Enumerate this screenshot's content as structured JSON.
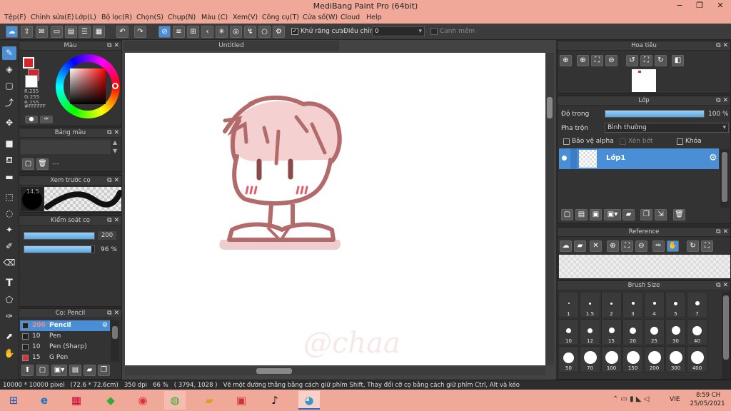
{
  "window": {
    "title": "MediBang Paint Pro (64bit)",
    "minimize": "−",
    "restore": "❐",
    "close": "✕"
  },
  "menu": [
    "Tệp(F)",
    "Chỉnh sửa(E)",
    "Lớp(L)",
    "Bộ lọc(R)",
    "Chọn(S)",
    "Chụp(N)",
    "Màu (C)",
    "Xem(V)",
    "Công cụ(T)",
    "Cửa số(W)",
    "Cloud",
    "Help"
  ],
  "toolbar": {
    "antialias_label": "Khử răng cưa",
    "adjust_label": "Điều chỉnh",
    "adjust_value": "0",
    "snap_label": "Canh mềm"
  },
  "color_panel": {
    "title": "Màu",
    "r": "R:255",
    "g": "G:255",
    "b": "B:255",
    "hex": "#FFFFFF",
    "fg": "#d9232a",
    "bg": "#ffffff"
  },
  "palette_panel": {
    "title": "Bảng màu",
    "dash": "---"
  },
  "brush_preview": {
    "title": "Xem trước cọ",
    "size": "14.5"
  },
  "brush_control": {
    "title": "Kiểm soát cọ",
    "size_value": "200",
    "opacity_value": "96 %",
    "size_fill": 1.0,
    "opacity_fill": 0.96
  },
  "brush_list": {
    "title": "Cọ: Pencil",
    "items": [
      {
        "size": "200",
        "name": "Pencil",
        "color": "#222222",
        "selected": true
      },
      {
        "size": "10",
        "name": "Pen",
        "color": "#222222",
        "selected": false
      },
      {
        "size": "10",
        "name": "Pen (Sharp)",
        "color": "#222222",
        "selected": false
      },
      {
        "size": "15",
        "name": "G Pen",
        "color": "#e03030",
        "selected": false
      }
    ]
  },
  "canvas": {
    "tab": "Untitled"
  },
  "navigator": {
    "title": "Hoa tiêu"
  },
  "layer_panel": {
    "title": "Lớp",
    "opacity_label": "Độ trong",
    "opacity_value": "100 %",
    "opacity_fill": 1.0,
    "blend_label": "Pha trộn",
    "blend_value": "Bình thường",
    "protect_alpha": "Bảo vệ alpha",
    "clipping": "Xén bớt",
    "lock": "Khóa",
    "layers": [
      {
        "name": "Lớp1"
      }
    ]
  },
  "reference_panel": {
    "title": "Reference"
  },
  "brush_size_panel": {
    "title": "Brush Size",
    "sizes": [
      {
        "label": "1",
        "v": 1
      },
      {
        "label": "1.5",
        "v": 1.5
      },
      {
        "label": "2",
        "v": 2
      },
      {
        "label": "3",
        "v": 3
      },
      {
        "label": "4",
        "v": 4
      },
      {
        "label": "5",
        "v": 5
      },
      {
        "label": "7",
        "v": 7
      },
      {
        "label": "10",
        "v": 10
      },
      {
        "label": "12",
        "v": 12
      },
      {
        "label": "15",
        "v": 15
      },
      {
        "label": "20",
        "v": 20
      },
      {
        "label": "25",
        "v": 25
      },
      {
        "label": "30",
        "v": 30
      },
      {
        "label": "40",
        "v": 40
      },
      {
        "label": "50",
        "v": 50
      },
      {
        "label": "70",
        "v": 70
      },
      {
        "label": "100",
        "v": 100
      },
      {
        "label": "150",
        "v": 150
      },
      {
        "label": "200",
        "v": 200
      },
      {
        "label": "300",
        "v": 300
      },
      {
        "label": "400",
        "v": 400
      }
    ]
  },
  "status": {
    "size": "10000 * 10000 pixel",
    "physical": "(72.6 * 72.6cm)",
    "dpi": "350 dpi",
    "zoom": "66 %",
    "coords": "( 3794, 1028 )",
    "hint": "Vẽ một đường thẳng bằng cách giữ phím Shift, Thay đổi cỡ cọ bằng cách giữ phím Ctrl, Alt và kéo"
  },
  "taskbar": {
    "lang": "VIE",
    "time": "8:59 CH",
    "date": "25/05/2021"
  }
}
